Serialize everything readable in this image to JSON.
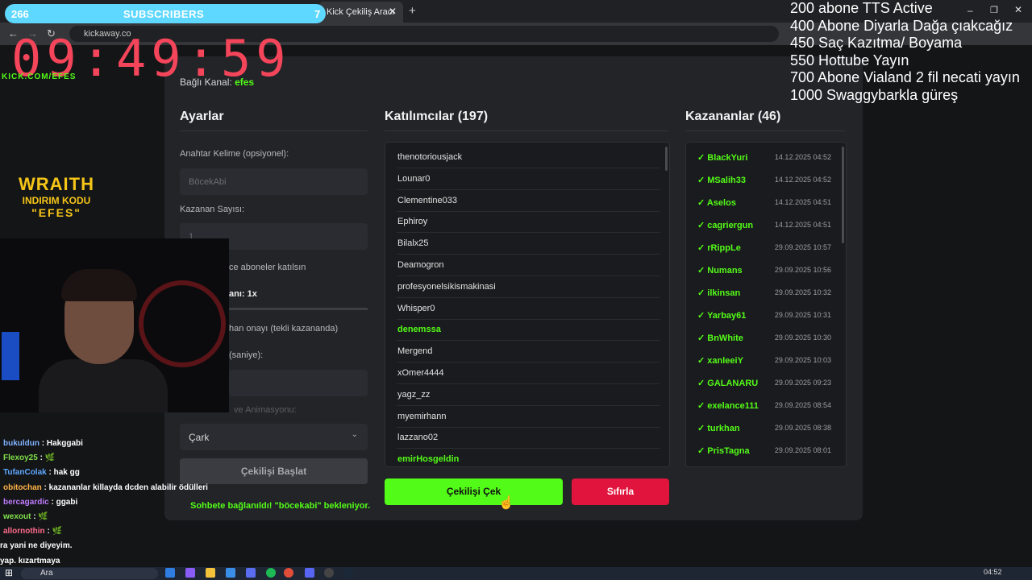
{
  "browser": {
    "tab_title": "Kick Çekiliş Aracı",
    "tab_close": "✕",
    "new_tab": "+",
    "url": "kickaway.co",
    "nav": {
      "back": "←",
      "forward": "→",
      "reload": "↻"
    },
    "window_controls": {
      "minimize": "–",
      "restore": "❐",
      "close": "✕"
    }
  },
  "page": {
    "channel_label": "Bağlı Kanal:",
    "channel_name": "efes",
    "settings": {
      "title": "Ayarlar",
      "keyword_label": "Anahtar Kelime (opsiyonel):",
      "keyword_placeholder": "BöcekAbi",
      "winner_count_label": "Kazanan Sayısı:",
      "winner_count_value": "1",
      "subs_only_label": "ce aboneler katılsın",
      "bonus_label": "anı: 1x",
      "confirm_label": "han onayı (tekli kazananda)",
      "time_label": "(saniye):",
      "animation_label": "ve Animasyonu:",
      "animation_value": "Çark",
      "start_button": "Çekilişi Başlat",
      "status": "Sohbete bağlanıldı! \"böcekabi\" bekleniyor."
    },
    "participants": {
      "title": "Katılımcılar (197)",
      "items": [
        {
          "name": "thenotoriousjack",
          "highlight": false
        },
        {
          "name": "Lounar0",
          "highlight": false
        },
        {
          "name": "Clementine033",
          "highlight": false
        },
        {
          "name": "Ephiroy",
          "highlight": false
        },
        {
          "name": "Bilalx25",
          "highlight": false
        },
        {
          "name": "Deamogron",
          "highlight": false
        },
        {
          "name": "profesyonelsikismakinasi",
          "highlight": false
        },
        {
          "name": "Whisper0",
          "highlight": false
        },
        {
          "name": "denemssa",
          "highlight": true
        },
        {
          "name": "Mergend",
          "highlight": false
        },
        {
          "name": "xOmer4444",
          "highlight": false
        },
        {
          "name": "yagz_zz",
          "highlight": false
        },
        {
          "name": "myemirhann",
          "highlight": false
        },
        {
          "name": "lazzano02",
          "highlight": false
        },
        {
          "name": "emirHosgeldin",
          "highlight": true
        }
      ]
    },
    "winners": {
      "title": "Kazananlar (46)",
      "items": [
        {
          "name": "✓ BlackYuri",
          "date": "14.12.2025 04:52"
        },
        {
          "name": "✓ MSalih33",
          "date": "14.12.2025 04:52"
        },
        {
          "name": "✓ Aselos",
          "date": "14.12.2025 04:51"
        },
        {
          "name": "✓ cagriergun",
          "date": "14.12.2025 04:51"
        },
        {
          "name": "✓ rRippLe",
          "date": "29.09.2025 10:57"
        },
        {
          "name": "✓ Numans",
          "date": "29.09.2025 10:56"
        },
        {
          "name": "✓ ilkinsan",
          "date": "29.09.2025 10:32"
        },
        {
          "name": "✓ Yarbay61",
          "date": "29.09.2025 10:31"
        },
        {
          "name": "✓ BnWhite",
          "date": "29.09.2025 10:30"
        },
        {
          "name": "✓ xanleeiY",
          "date": "29.09.2025 10:03"
        },
        {
          "name": "✓ GALANARU",
          "date": "29.09.2025 09:23"
        },
        {
          "name": "✓ exelance111",
          "date": "29.09.2025 08:54"
        },
        {
          "name": "✓ turkhan",
          "date": "29.09.2025 08:38"
        },
        {
          "name": "✓ PrisTagna",
          "date": "29.09.2025 08:01"
        }
      ]
    },
    "draw_button": "Çekilişi Çek",
    "reset_button": "Sıfırla"
  },
  "overlay": {
    "sub_count": "266",
    "sub_label": "SUBSCRIBERS",
    "sub_right": "7",
    "timer": "09:49:59",
    "kick_handle": "KICK.COM/EFES",
    "goals": [
      "200 abone TTS Active",
      "400 Abone Diyarla Dağa çıakcağız",
      "450 Saç Kazıtma/ Boyama",
      "550 Hottube Yayın",
      "700 Abone Vialand 2 fil necati yayın",
      "1000 Swaggybarkla güreş"
    ],
    "sponsor": {
      "brand": "WRAITH",
      "line1": "INDIRIM KODU",
      "line2": "\"EFES\""
    },
    "chat": [
      {
        "user": "bukuldun",
        "color": "#7fb2ff",
        "msg": " : Hakggabi"
      },
      {
        "user": "Flexoy25",
        "color": "#7fe04a",
        "msg": " : 🌿"
      },
      {
        "user": "TufanColak",
        "color": "#5ea8ff",
        "msg": " : hak gg"
      },
      {
        "user": "obitochan",
        "color": "#ffb347",
        "msg": " : kazananlar killayda dcden alabilir ödülleri"
      },
      {
        "user": "bercagardic",
        "color": "#c07cff",
        "msg": " : ggabi"
      },
      {
        "user": "wexout",
        "color": "#7fe04a",
        "msg": " : 🌿"
      },
      {
        "user": "allornothin",
        "color": "#ff6b8a",
        "msg": " : 🌿"
      },
      {
        "user": "",
        "color": "#ffffff",
        "msg": "ra yani ne diyeyim."
      },
      {
        "user": "",
        "color": "#ffffff",
        "msg": "yap. kızartmaya"
      }
    ]
  },
  "taskbar": {
    "search_placeholder": "Ara",
    "time": "04:52"
  }
}
